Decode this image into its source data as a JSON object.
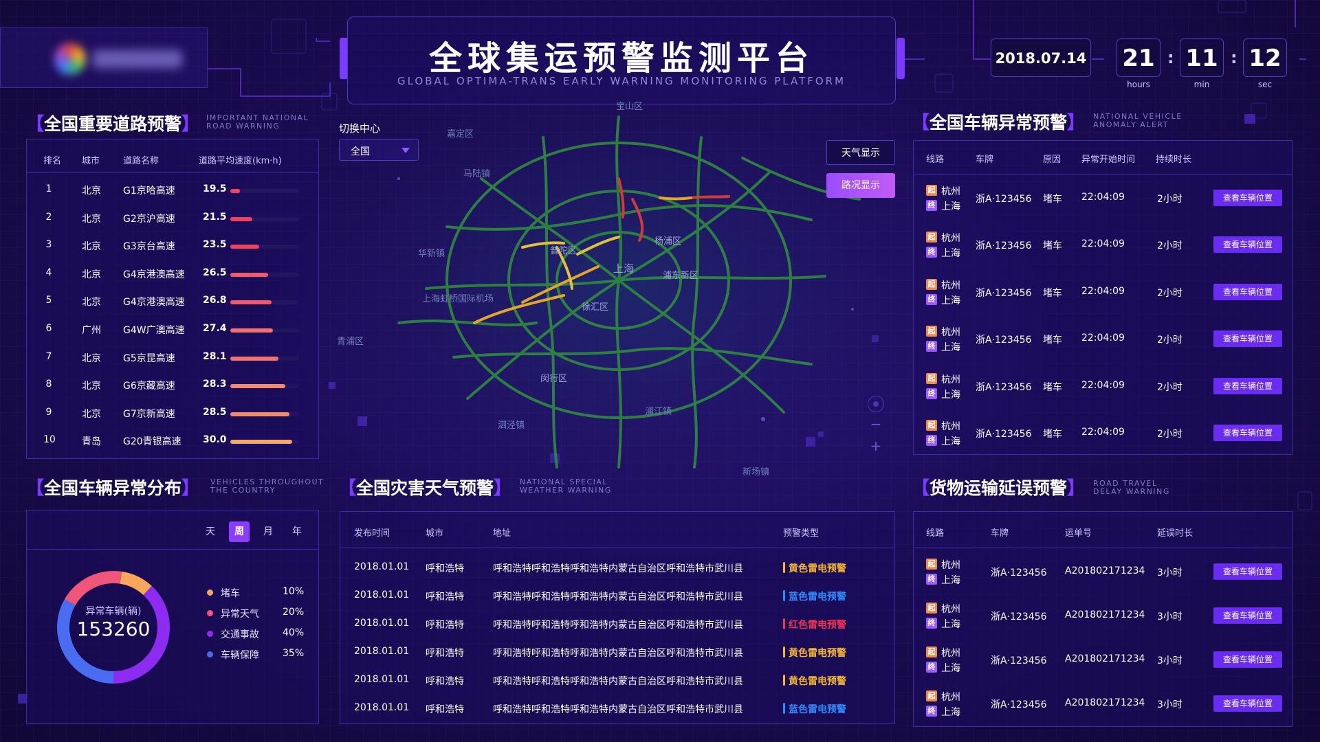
{
  "header": {
    "title": "全球集运预警监测平台",
    "subtitle": "GLOBAL OPTIMA-TRANS EARLY WARNING MONITORING PLATFORM",
    "date": "2018.07.14",
    "hours": "21",
    "minutes": "11",
    "seconds": "12",
    "hours_label": "hours",
    "minutes_label": "min",
    "seconds_label": "sec"
  },
  "road_warning": {
    "title": "全国重要道路预警",
    "title_en_1": "IMPORTANT NATIONAL",
    "title_en_2": "ROAD WARNING",
    "columns": [
      "排名",
      "城市",
      "道路名称",
      "道路平均速度(km·h)"
    ],
    "rows": [
      {
        "rank": "1",
        "city": "北京",
        "road": "G1京哈高速",
        "speed": "19.5",
        "fill": 0.14,
        "color": "#f0415e"
      },
      {
        "rank": "2",
        "city": "北京",
        "road": "G2京沪高速",
        "speed": "21.5",
        "fill": 0.32,
        "color": "#f0415e"
      },
      {
        "rank": "3",
        "city": "北京",
        "road": "G3京台高速",
        "speed": "23.5",
        "fill": 0.42,
        "color": "#f0415e"
      },
      {
        "rank": "4",
        "city": "北京",
        "road": "G4京港澳高速",
        "speed": "26.5",
        "fill": 0.55,
        "color": "#f25a6a"
      },
      {
        "rank": "5",
        "city": "北京",
        "road": "G4京港澳高速",
        "speed": "26.8",
        "fill": 0.6,
        "color": "#f25a6a"
      },
      {
        "rank": "6",
        "city": "广州",
        "road": "G4W广澳高速",
        "speed": "27.4",
        "fill": 0.62,
        "color": "#f2706e"
      },
      {
        "rank": "7",
        "city": "北京",
        "road": "G5京昆高速",
        "speed": "28.1",
        "fill": 0.7,
        "color": "#f2706e"
      },
      {
        "rank": "8",
        "city": "北京",
        "road": "G6京藏高速",
        "speed": "28.3",
        "fill": 0.8,
        "color": "#f38a6c"
      },
      {
        "rank": "9",
        "city": "北京",
        "road": "G7京新高速",
        "speed": "28.5",
        "fill": 0.86,
        "color": "#f38a6c"
      },
      {
        "rank": "10",
        "city": "青岛",
        "road": "G20青银高速",
        "speed": "30.0",
        "fill": 0.9,
        "color": "#f4a66c"
      }
    ]
  },
  "distribution": {
    "title": "全国车辆异常分布",
    "title_en_1": "VEHICLES THROUGHOUT",
    "title_en_2": "THE COUNTRY",
    "tabs": [
      "天",
      "周",
      "月",
      "年"
    ],
    "active_tab": "周",
    "center_label": "异常车辆(辆)",
    "center_value": "153260",
    "legend": [
      {
        "label": "堵车",
        "value": "10%",
        "color": "#f7a75a"
      },
      {
        "label": "异常天气",
        "value": "20%",
        "color": "#f0557a"
      },
      {
        "label": "交通事故",
        "value": "40%",
        "color": "#8b2cf0"
      },
      {
        "label": "车辆保障",
        "value": "35%",
        "color": "#4a6cf0"
      }
    ]
  },
  "map": {
    "switch_label": "切换中心",
    "select_value": "全国",
    "weather_btn": "天气显示",
    "traffic_btn": "路况显示",
    "places": [
      "宝山区",
      "嘉定区",
      "马陆镇",
      "华新镇",
      "普陀区",
      "杨浦区",
      "上海",
      "浦东新区",
      "徐汇区",
      "上海虹桥国际机场",
      "闵行区",
      "浦江镇",
      "新场镇",
      "青浦区",
      "泗泾镇"
    ]
  },
  "weather": {
    "title": "全国灾害天气预警",
    "title_en_1": "NATIONAL SPECIAL",
    "title_en_2": "WEATHER WARNING",
    "columns": [
      "发布时间",
      "城市",
      "地址",
      "预警类型"
    ],
    "rows": [
      {
        "date": "2018.01.01",
        "city": "呼和浩特",
        "address": "呼和浩特呼和浩特呼和浩特内蒙古自治区呼和浩特市武川县",
        "type": "黄色雷电预警",
        "color": "#f7b731"
      },
      {
        "date": "2018.01.01",
        "city": "呼和浩特",
        "address": "呼和浩特呼和浩特呼和浩特内蒙古自治区呼和浩特市武川县",
        "type": "蓝色雷电预警",
        "color": "#2f8cff"
      },
      {
        "date": "2018.01.01",
        "city": "呼和浩特",
        "address": "呼和浩特呼和浩特呼和浩特内蒙古自治区呼和浩特市武川县",
        "type": "红色雷电预警",
        "color": "#f0334e"
      },
      {
        "date": "2018.01.01",
        "city": "呼和浩特",
        "address": "呼和浩特呼和浩特呼和浩特内蒙古自治区呼和浩特市武川县",
        "type": "黄色雷电预警",
        "color": "#f7b731"
      },
      {
        "date": "2018.01.01",
        "city": "呼和浩特",
        "address": "呼和浩特呼和浩特呼和浩特内蒙古自治区呼和浩特市武川县",
        "type": "黄色雷电预警",
        "color": "#f7b731"
      },
      {
        "date": "2018.01.01",
        "city": "呼和浩特",
        "address": "呼和浩特呼和浩特呼和浩特内蒙古自治区呼和浩特市武川县",
        "type": "蓝色雷电预警",
        "color": "#2f8cff"
      }
    ]
  },
  "vehicle_anomaly": {
    "title": "全国车辆异常预警",
    "title_en_1": "NATIONAL VEHICLE",
    "title_en_2": "ANOMALY ALERT",
    "columns": [
      "线路",
      "车牌",
      "原因",
      "异常开始时间",
      "持续时长"
    ],
    "start_tag": "起",
    "end_tag": "终",
    "rows": [
      {
        "from": "杭州",
        "to": "上海",
        "plate": "浙A·123456",
        "reason": "堵车",
        "time": "22:04:09",
        "duration": "2小时",
        "action": "查看车辆位置"
      },
      {
        "from": "杭州",
        "to": "上海",
        "plate": "浙A·123456",
        "reason": "堵车",
        "time": "22:04:09",
        "duration": "2小时",
        "action": "查看车辆位置"
      },
      {
        "from": "杭州",
        "to": "上海",
        "plate": "浙A·123456",
        "reason": "堵车",
        "time": "22:04:09",
        "duration": "2小时",
        "action": "查看车辆位置"
      },
      {
        "from": "杭州",
        "to": "上海",
        "plate": "浙A·123456",
        "reason": "堵车",
        "time": "22:04:09",
        "duration": "2小时",
        "action": "查看车辆位置"
      },
      {
        "from": "杭州",
        "to": "上海",
        "plate": "浙A·123456",
        "reason": "堵车",
        "time": "22:04:09",
        "duration": "2小时",
        "action": "查看车辆位置"
      },
      {
        "from": "杭州",
        "to": "上海",
        "plate": "浙A·123456",
        "reason": "堵车",
        "time": "22:04:09",
        "duration": "2小时",
        "action": "查看车辆位置"
      }
    ]
  },
  "delay": {
    "title": "货物运输延误预警",
    "title_en_1": "ROAD TRAVEL",
    "title_en_2": "DELAY WARNING",
    "columns": [
      "线路",
      "车牌",
      "运单号",
      "延误时长"
    ],
    "rows": [
      {
        "from": "杭州",
        "to": "上海",
        "plate": "浙A·123456",
        "waybill": "A201802171234",
        "duration": "3小时",
        "action": "查看车辆位置"
      },
      {
        "from": "杭州",
        "to": "上海",
        "plate": "浙A·123456",
        "waybill": "A201802171234",
        "duration": "3小时",
        "action": "查看车辆位置"
      },
      {
        "from": "杭州",
        "to": "上海",
        "plate": "浙A·123456",
        "waybill": "A201802171234",
        "duration": "3小时",
        "action": "查看车辆位置"
      },
      {
        "from": "杭州",
        "to": "上海",
        "plate": "浙A·123456",
        "waybill": "A201802171234",
        "duration": "3小时",
        "action": "查看车辆位置"
      }
    ]
  }
}
